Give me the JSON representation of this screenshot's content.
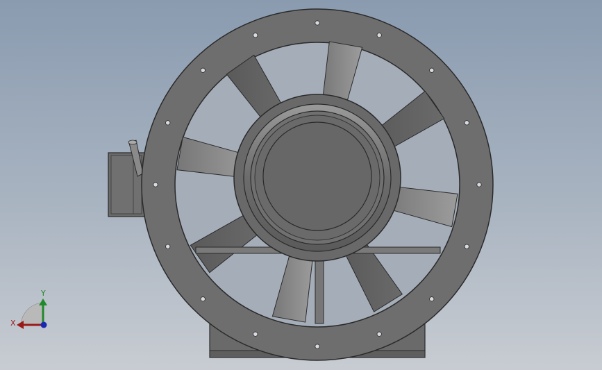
{
  "model": {
    "name": "axial fan",
    "view": "front",
    "blade_count": 8,
    "flange_hole_count": 16,
    "colors": {
      "body": "#6e6e6e",
      "body_dark": "#4a4a4a",
      "body_light": "#8a8a8a",
      "edge": "#2a2a2a",
      "background_top": "#8a9bb0",
      "background_bottom": "#c8ccd2"
    }
  },
  "triad": {
    "x_label": "X",
    "y_label": "Y",
    "x_color": "#9a1a1a",
    "y_color": "#1f8a2a",
    "z_color": "#1a2ab0"
  }
}
